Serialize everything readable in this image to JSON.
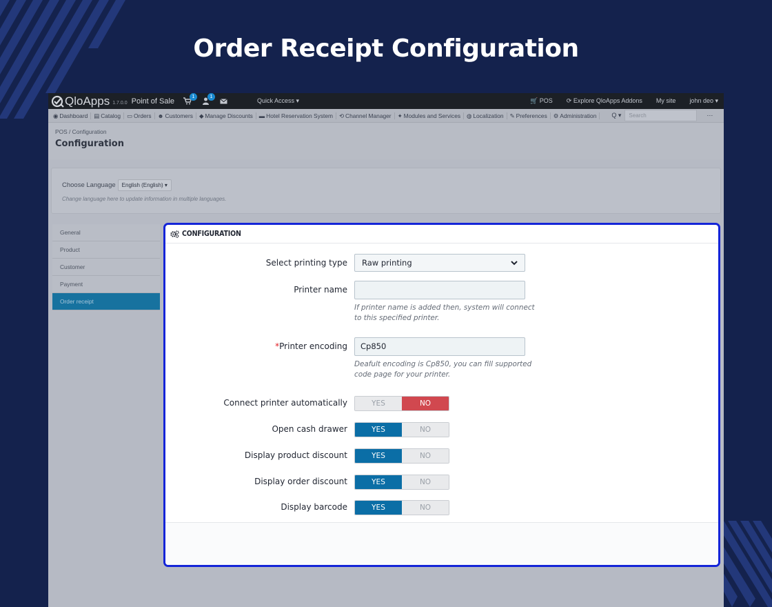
{
  "headline": "Order Receipt Configuration",
  "app": {
    "logo_text": "QloApps",
    "version": "1.7.0.0",
    "module": "Point of Sale",
    "cart_badge": "1",
    "user_badge": "1",
    "quick_access": "Quick Access ▾",
    "pos_link": "POS",
    "addons_link": "Explore QloApps Addons",
    "mysite_link": "My site",
    "user_menu": "john deo ▾"
  },
  "menu": {
    "items": [
      "Dashboard",
      "Catalog",
      "Orders",
      "Customers",
      "Manage Discounts",
      "Hotel Reservation System",
      "Channel Manager",
      "Modules and Services",
      "Localization",
      "Preferences",
      "Administration"
    ],
    "search_placeholder": "Search",
    "search_btn": "Q ▾",
    "more": "⋯"
  },
  "page": {
    "breadcrumb": "POS  /  Configuration",
    "title": "Configuration"
  },
  "language": {
    "label": "Choose Language",
    "selected": "English (English) ▾",
    "hint": "Change language here to update information in multiple languages."
  },
  "sidenav": {
    "items": [
      "General",
      "Product",
      "Customer",
      "Payment",
      "Order receipt"
    ],
    "active_index": 4
  },
  "panel": {
    "title": "CONFIGURATION",
    "printing_type_label": "Select printing type",
    "printing_type_value": "Raw printing",
    "printer_name_label": "Printer name",
    "printer_name_value": "",
    "printer_name_help": "If printer name is added then, system will connect to this specified printer.",
    "encoding_required": "*",
    "encoding_label": "Printer encoding",
    "encoding_value": "Cp850",
    "encoding_help": "Deafult encoding is Cp850, you can fill supported code page for your printer.",
    "yes_label": "YES",
    "no_label": "NO",
    "toggles": [
      {
        "label": "Connect printer automatically",
        "value": "NO"
      },
      {
        "label": "Open cash drawer",
        "value": "YES"
      },
      {
        "label": "Display product discount",
        "value": "YES"
      },
      {
        "label": "Display order discount",
        "value": "YES"
      },
      {
        "label": "Display barcode",
        "value": "YES"
      }
    ]
  },
  "colors": {
    "background": "#14224d",
    "highlight_border": "#1424d8",
    "switch_yes": "#0b6ea6",
    "switch_no": "#d1484f",
    "active_nav": "#17729f"
  }
}
